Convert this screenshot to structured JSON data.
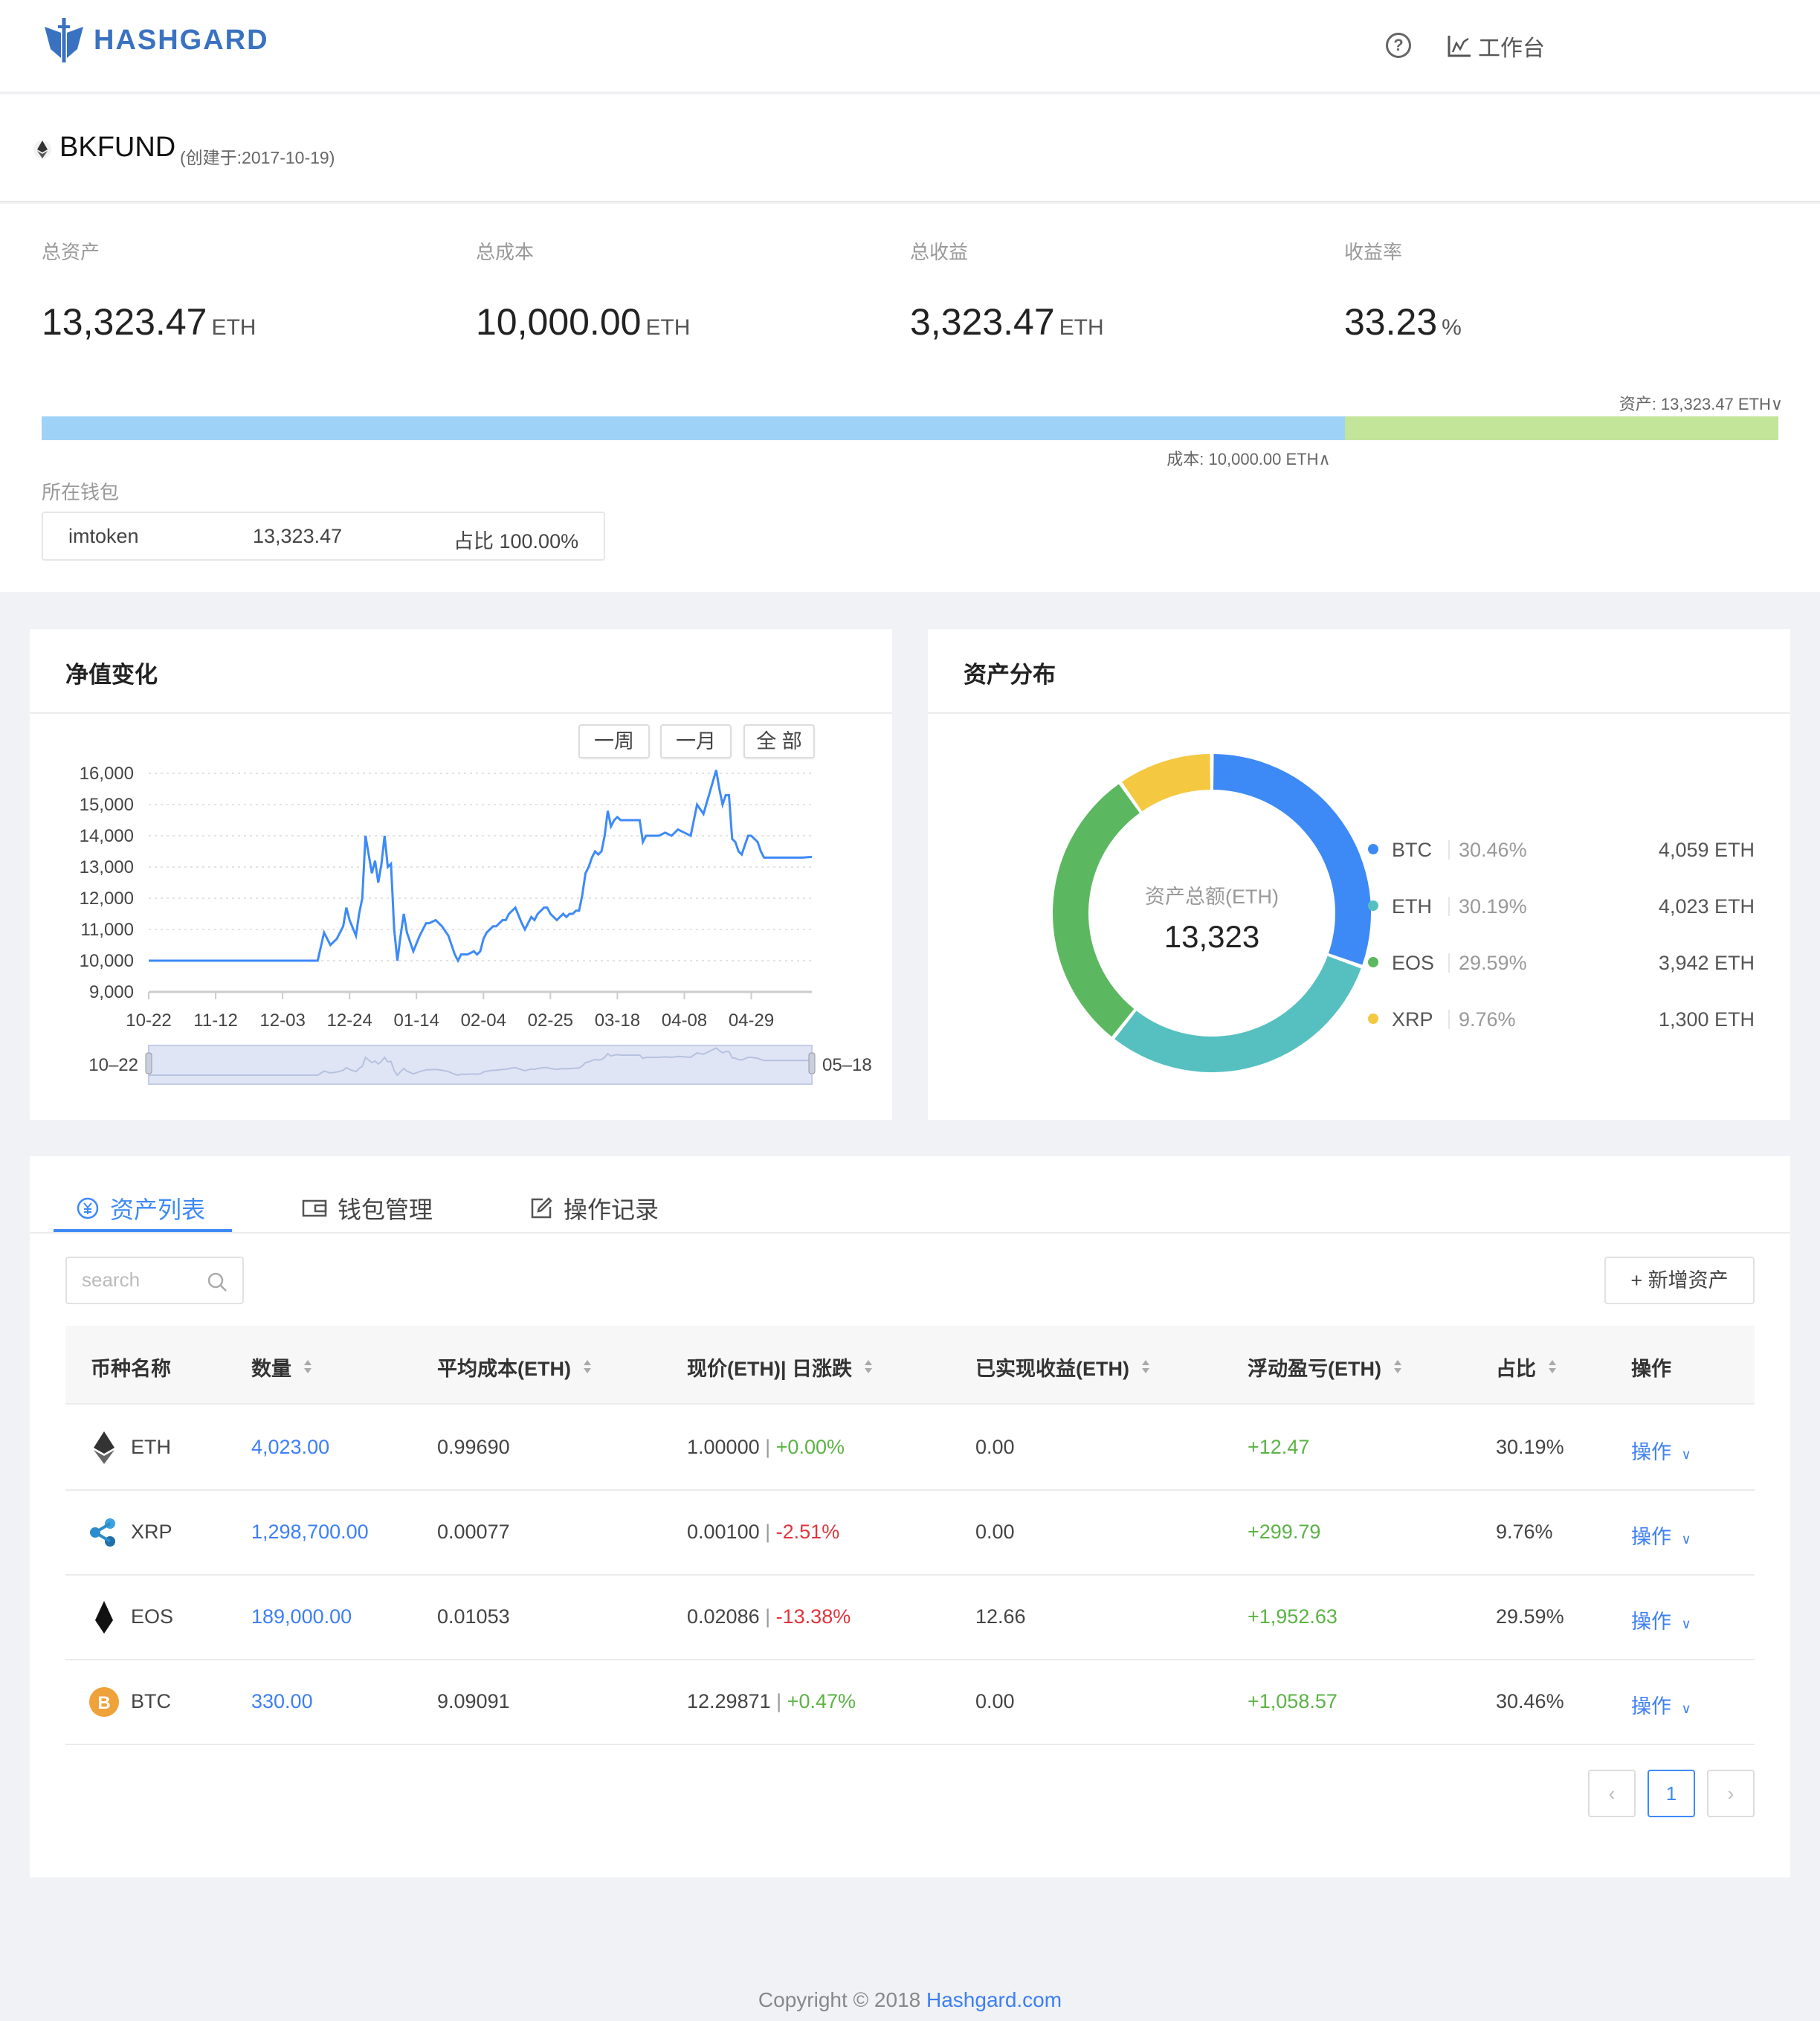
{
  "header": {
    "brand": "HASHGARD",
    "help_icon": "question-circle-icon",
    "workbench_icon": "line-chart-icon",
    "workbench_label": "工作台"
  },
  "fund": {
    "icon": "ethereum-icon",
    "name": "BKFUND",
    "created": "(创建于:2017-10-19)"
  },
  "stats": [
    {
      "label": "总资产",
      "value": "13,323.47",
      "unit": "ETH"
    },
    {
      "label": "总成本",
      "value": "10,000.00",
      "unit": "ETH"
    },
    {
      "label": "总收益",
      "value": "3,323.47",
      "unit": "ETH"
    },
    {
      "label": "收益率",
      "value": "33.23",
      "unit": "%"
    }
  ],
  "cost_bar": {
    "asset_label": "资产: 13,323.47 ETH∨",
    "cost_label": "成本: 10,000.00 ETH∧",
    "asset_total": 13323.47,
    "cost_total": 10000.0,
    "colors": {
      "cost": "#9ed2f7",
      "gain": "#c2e59a"
    }
  },
  "wallet": {
    "title": "所在钱包",
    "name": "imtoken",
    "amount": "13,323.47",
    "share": "占比 100.00%"
  },
  "nav_card": {
    "title": "净值变化",
    "ranges": [
      "一周",
      "一月",
      "全 部"
    ],
    "slider_start": "10–22",
    "slider_end": "05–18"
  },
  "alloc_card": {
    "title": "资产分布",
    "center_label": "资产总额(ETH)",
    "center_value": "13,323"
  },
  "chart_data": [
    {
      "type": "line",
      "title": "净值变化",
      "xlabel": "",
      "ylabel": "",
      "ylim": [
        9000,
        16000
      ],
      "yticks": [
        "16,000",
        "15,000",
        "14,000",
        "13,000",
        "12,000",
        "11,000",
        "10,000",
        "9,000"
      ],
      "ytick_values": [
        16000,
        15000,
        14000,
        13000,
        12000,
        11000,
        10000,
        9000
      ],
      "xticks": [
        "10-22",
        "11-12",
        "12-03",
        "12-24",
        "01-14",
        "02-04",
        "02-25",
        "03-18",
        "04-08",
        "04-29"
      ],
      "x_range_days": [
        0,
        208
      ],
      "grid": true,
      "color": "#3d8af7",
      "series": [
        {
          "name": "NAV",
          "x": [
            0,
            20,
            40,
            53,
            55,
            57,
            59,
            61,
            62,
            63,
            65,
            66,
            67,
            68,
            70,
            71,
            72,
            73,
            74,
            75,
            76,
            77,
            78,
            79,
            80,
            81,
            83,
            85,
            87,
            88,
            90,
            91,
            92,
            94,
            95,
            96,
            97,
            98,
            100,
            102,
            103,
            104,
            105,
            106,
            107,
            108,
            109,
            110,
            111,
            112,
            113,
            115,
            117,
            118,
            119,
            120,
            121,
            122,
            123,
            124,
            125,
            126,
            127,
            128,
            129,
            130,
            131,
            132,
            133,
            134,
            135,
            136,
            137,
            138,
            139,
            140,
            141,
            142,
            143,
            144,
            145,
            146,
            147,
            148,
            149,
            150,
            151,
            152,
            153,
            154,
            155,
            156,
            157,
            158,
            159,
            160,
            162,
            164,
            166,
            168,
            170,
            171,
            172,
            174,
            176,
            178,
            179,
            180,
            181,
            182,
            183,
            184,
            185,
            186,
            187,
            188,
            189,
            190,
            191,
            192,
            193,
            194,
            195,
            196,
            197,
            199,
            201,
            203,
            205,
            208
          ],
          "y": [
            10000,
            10000,
            10000,
            10000,
            10900,
            10500,
            10700,
            11100,
            11700,
            11300,
            10800,
            11500,
            12000,
            14000,
            12800,
            13200,
            12500,
            13100,
            14000,
            13000,
            13100,
            11000,
            10000,
            10800,
            11500,
            10900,
            10300,
            10800,
            11200,
            11200,
            11300,
            11200,
            11100,
            10800,
            10500,
            10200,
            10000,
            10200,
            10200,
            10300,
            10200,
            10300,
            10700,
            10900,
            11000,
            11100,
            11100,
            11200,
            11300,
            11300,
            11500,
            11700,
            11200,
            11000,
            11200,
            11400,
            11300,
            11500,
            11600,
            11700,
            11700,
            11500,
            11400,
            11300,
            11400,
            11500,
            11400,
            11500,
            11500,
            11600,
            11600,
            12100,
            12800,
            13000,
            13300,
            13500,
            13400,
            13500,
            14000,
            14800,
            14300,
            14500,
            14600,
            14500,
            14500,
            14500,
            14500,
            14500,
            14500,
            14500,
            13800,
            14000,
            14000,
            14000,
            14000,
            14000,
            14100,
            14000,
            14200,
            14100,
            14000,
            14500,
            15000,
            14700,
            15400,
            16100,
            15500,
            15000,
            15300,
            15300,
            13900,
            13800,
            13500,
            13400,
            13700,
            14000,
            14000,
            13900,
            13800,
            13500,
            13300,
            13300,
            13300,
            13300,
            13300,
            13300,
            13300,
            13300,
            13300,
            13323
          ]
        }
      ]
    },
    {
      "type": "pie",
      "title": "资产分布",
      "donut": true,
      "center_label": "资产总额(ETH)",
      "center_value": "13,323",
      "legend_position": "right",
      "slices": [
        {
          "name": "BTC",
          "percent": "30.46%",
          "value": 4059,
          "label": "4,059 ETH",
          "color": "#3d8af7"
        },
        {
          "name": "ETH",
          "percent": "30.19%",
          "value": 4023,
          "label": "4,023 ETH",
          "color": "#56c0c0"
        },
        {
          "name": "EOS",
          "percent": "29.59%",
          "value": 3942,
          "label": "3,942 ETH",
          "color": "#5cb860"
        },
        {
          "name": "XRP",
          "percent": "9.76%",
          "value": 1300,
          "label": "1,300 ETH",
          "color": "#f5c842"
        }
      ]
    }
  ],
  "tabs": [
    {
      "label": "资产列表",
      "icon": "yuan-circle-icon",
      "active": true
    },
    {
      "label": "钱包管理",
      "icon": "wallet-icon",
      "active": false
    },
    {
      "label": "操作记录",
      "icon": "edit-icon",
      "active": false
    }
  ],
  "toolbar": {
    "search_placeholder": "search",
    "search_value": "",
    "add_asset_label": "+ 新增资产"
  },
  "table": {
    "columns": [
      "币种名称",
      "数量",
      "平均成本(ETH)",
      "现价(ETH)| 日涨跌",
      "已实现收益(ETH)",
      "浮动盈亏(ETH)",
      "占比",
      "操作"
    ],
    "rows": [
      {
        "coin": "ETH",
        "icon": "ethereum-icon",
        "qty": "4,023.00",
        "avg_cost": "0.99690",
        "price": "1.00000",
        "change": "+0.00%",
        "change_dir": "pos",
        "realized": "0.00",
        "floating": "+12.47",
        "share": "30.19%",
        "action": "操作"
      },
      {
        "coin": "XRP",
        "icon": "ripple-icon",
        "qty": "1,298,700.00",
        "avg_cost": "0.00077",
        "price": "0.00100",
        "change": "-2.51%",
        "change_dir": "neg",
        "realized": "0.00",
        "floating": "+299.79",
        "share": "9.76%",
        "action": "操作"
      },
      {
        "coin": "EOS",
        "icon": "eos-icon",
        "qty": "189,000.00",
        "avg_cost": "0.01053",
        "price": "0.02086",
        "change": "-13.38%",
        "change_dir": "neg",
        "realized": "12.66",
        "floating": "+1,952.63",
        "share": "29.59%",
        "action": "操作"
      },
      {
        "coin": "BTC",
        "icon": "bitcoin-icon",
        "qty": "330.00",
        "avg_cost": "9.09091",
        "price": "12.29871",
        "change": "+0.47%",
        "change_dir": "pos",
        "realized": "0.00",
        "floating": "+1,058.57",
        "share": "30.46%",
        "action": "操作"
      }
    ]
  },
  "pagination": {
    "prev": "‹",
    "current": "1",
    "next": "›"
  },
  "footer": {
    "text": "Copyright © 2018 ",
    "link": "Hashgard.com"
  }
}
